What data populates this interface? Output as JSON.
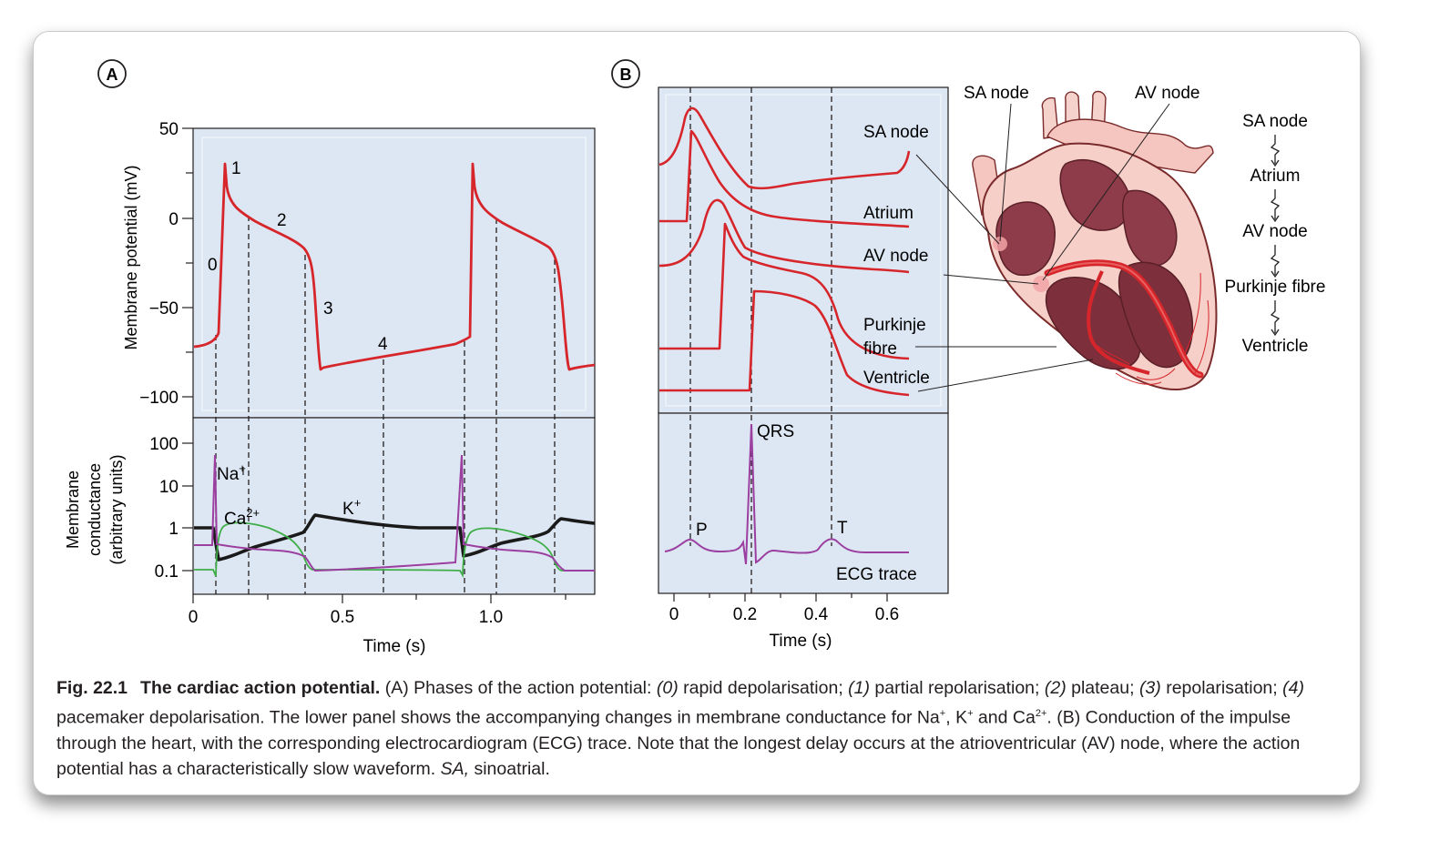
{
  "panel_a": {
    "letter": "A",
    "upper_ylabel": "Membrane potential (mV)",
    "upper_yticks": [
      "50",
      "0",
      "−50",
      "−100"
    ],
    "phase_labels": [
      "0",
      "1",
      "2",
      "3",
      "4"
    ],
    "lower_ylabel_line1": "Membrane",
    "lower_ylabel_line2": "conductance",
    "lower_ylabel_line3": "(arbitrary units)",
    "lower_yticks": [
      "100",
      "10",
      "1",
      "0.1"
    ],
    "ion_na": "Na",
    "ion_na_sup": "+",
    "ion_ca": "Ca",
    "ion_ca_sup": "2+",
    "ion_k": "K",
    "ion_k_sup": "+",
    "xticks": [
      "0",
      "0.5",
      "1.0"
    ],
    "xlabel": "Time (s)"
  },
  "panel_b": {
    "letter": "B",
    "trace_labels": [
      "SA node",
      "Atrium",
      "AV node",
      "Purkinje",
      "fibre",
      "Ventricle"
    ],
    "ecg_labels": [
      "QRS",
      "P",
      "T"
    ],
    "ecg_caption": "ECG trace",
    "xticks": [
      "0",
      "0.2",
      "0.4",
      "0.6"
    ],
    "xlabel": "Time (s)"
  },
  "heart": {
    "label_sa": "SA node",
    "label_av": "AV node"
  },
  "pathway": [
    "SA node",
    "Atrium",
    "AV node",
    "Purkinje fibre",
    "Ventricle"
  ],
  "caption": {
    "fig_number": "Fig. 22.1",
    "title": "The cardiac action potential.",
    "t1": " (A) Phases of the action potential: ",
    "p0": "(0)",
    "t2": " rapid depolarisation; ",
    "p1": "(1)",
    "t3": " partial repolarisation; ",
    "p2": "(2)",
    "t4": " plateau; ",
    "p3": "(3)",
    "t5": " repolarisation; ",
    "p4": "(4)",
    "t6": " pacemaker depolarisation. The lower panel shows the accompanying changes in membrane conductance for Na",
    "s1": "+",
    "t7": ", K",
    "s2": "+",
    "t8": " and Ca",
    "s3": "2+",
    "t9": ". (B) Conduction of the impulse through the heart, with the corresponding electrocardiogram (ECG) trace. Note that the longest delay occurs at the atrioventricular (AV) node, where the action potential has a characteristically slow waveform. ",
    "sa_italic": "SA,",
    "t10": " sinoatrial."
  },
  "colors": {
    "panel_bg": "#dde7f3",
    "trace_red": "#d7262b",
    "ecg_purple": "#9b3fa0",
    "ca_green": "#3fae49",
    "k_black": "#1a1a1a"
  }
}
